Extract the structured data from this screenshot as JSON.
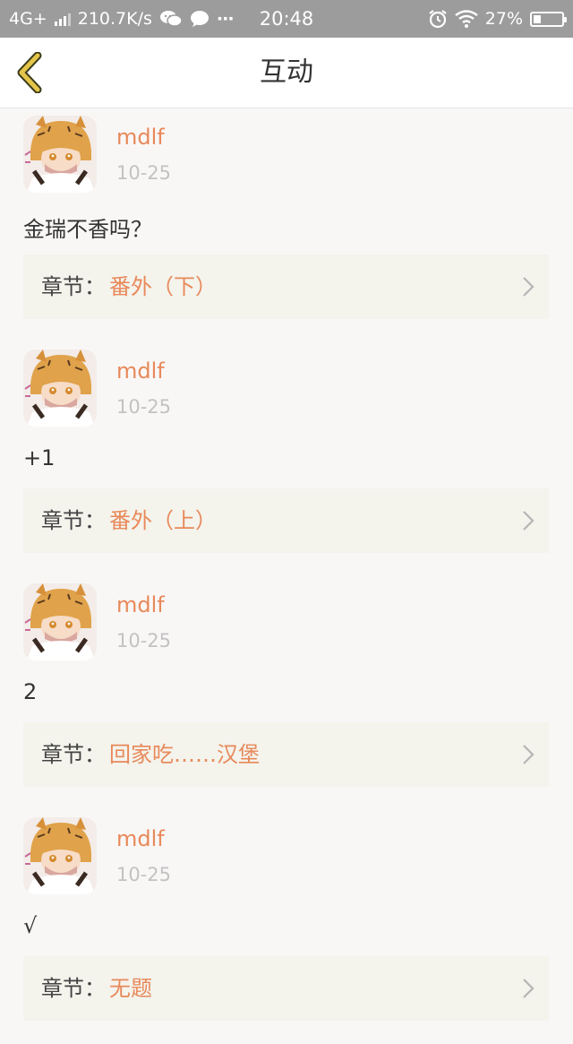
{
  "statusbar": {
    "network": "4G+",
    "speed": "210.7K/s",
    "time": "20:48",
    "battery": "27%",
    "battery_level": 0.27,
    "dots": "···"
  },
  "navbar": {
    "title": "互动"
  },
  "colors": {
    "accent": "#e8895a",
    "back": "#e4c54a",
    "card": "#f4f3ec"
  },
  "feed": [
    {
      "username": "mdlf",
      "date": "10-25",
      "comment": "金瑞不香吗？",
      "chapter_label": "章节：",
      "chapter": "番外（下）"
    },
    {
      "username": "mdlf",
      "date": "10-25",
      "comment": "+1",
      "chapter_label": "章节：",
      "chapter": "番外（上）"
    },
    {
      "username": "mdlf",
      "date": "10-25",
      "comment": "2",
      "chapter_label": "章节：",
      "chapter": "回家吃……汉堡"
    },
    {
      "username": "mdlf",
      "date": "10-25",
      "comment": "√",
      "chapter_label": "章节：",
      "chapter": "无题"
    }
  ]
}
